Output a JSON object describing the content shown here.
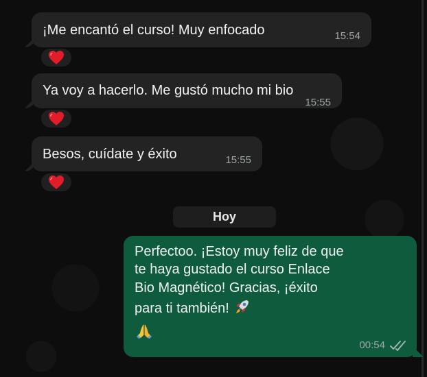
{
  "chat": {
    "date_label": "Hoy",
    "messages": [
      {
        "direction": "incoming",
        "text": "¡Me encantó el curso! Muy enfocado",
        "time": "15:54",
        "reaction": "red-heart"
      },
      {
        "direction": "incoming",
        "text": "Ya voy a hacerlo. Me gustó mucho mi bio",
        "time": "15:55",
        "reaction": "red-heart"
      },
      {
        "direction": "incoming",
        "text": "Besos, cuídate y éxito",
        "time": "15:55",
        "reaction": "red-heart"
      },
      {
        "direction": "outgoing",
        "lines": [
          "Perfectoo. ¡Estoy muy feliz de que",
          "te haya gustado el curso Enlace",
          "Bio Magnético! Gracias, ¡éxito",
          "para ti también!"
        ],
        "time": "00:54",
        "status": "read",
        "emojis": [
          "rocket",
          "folded-hands"
        ]
      }
    ]
  },
  "colors": {
    "background": "#0d0d0d",
    "incoming_bubble": "#232323",
    "outgoing_bubble": "#0e5b3d",
    "text": "#f0f2f5",
    "timestamp": "#9ea4a7",
    "heart": "#e11d2a"
  }
}
